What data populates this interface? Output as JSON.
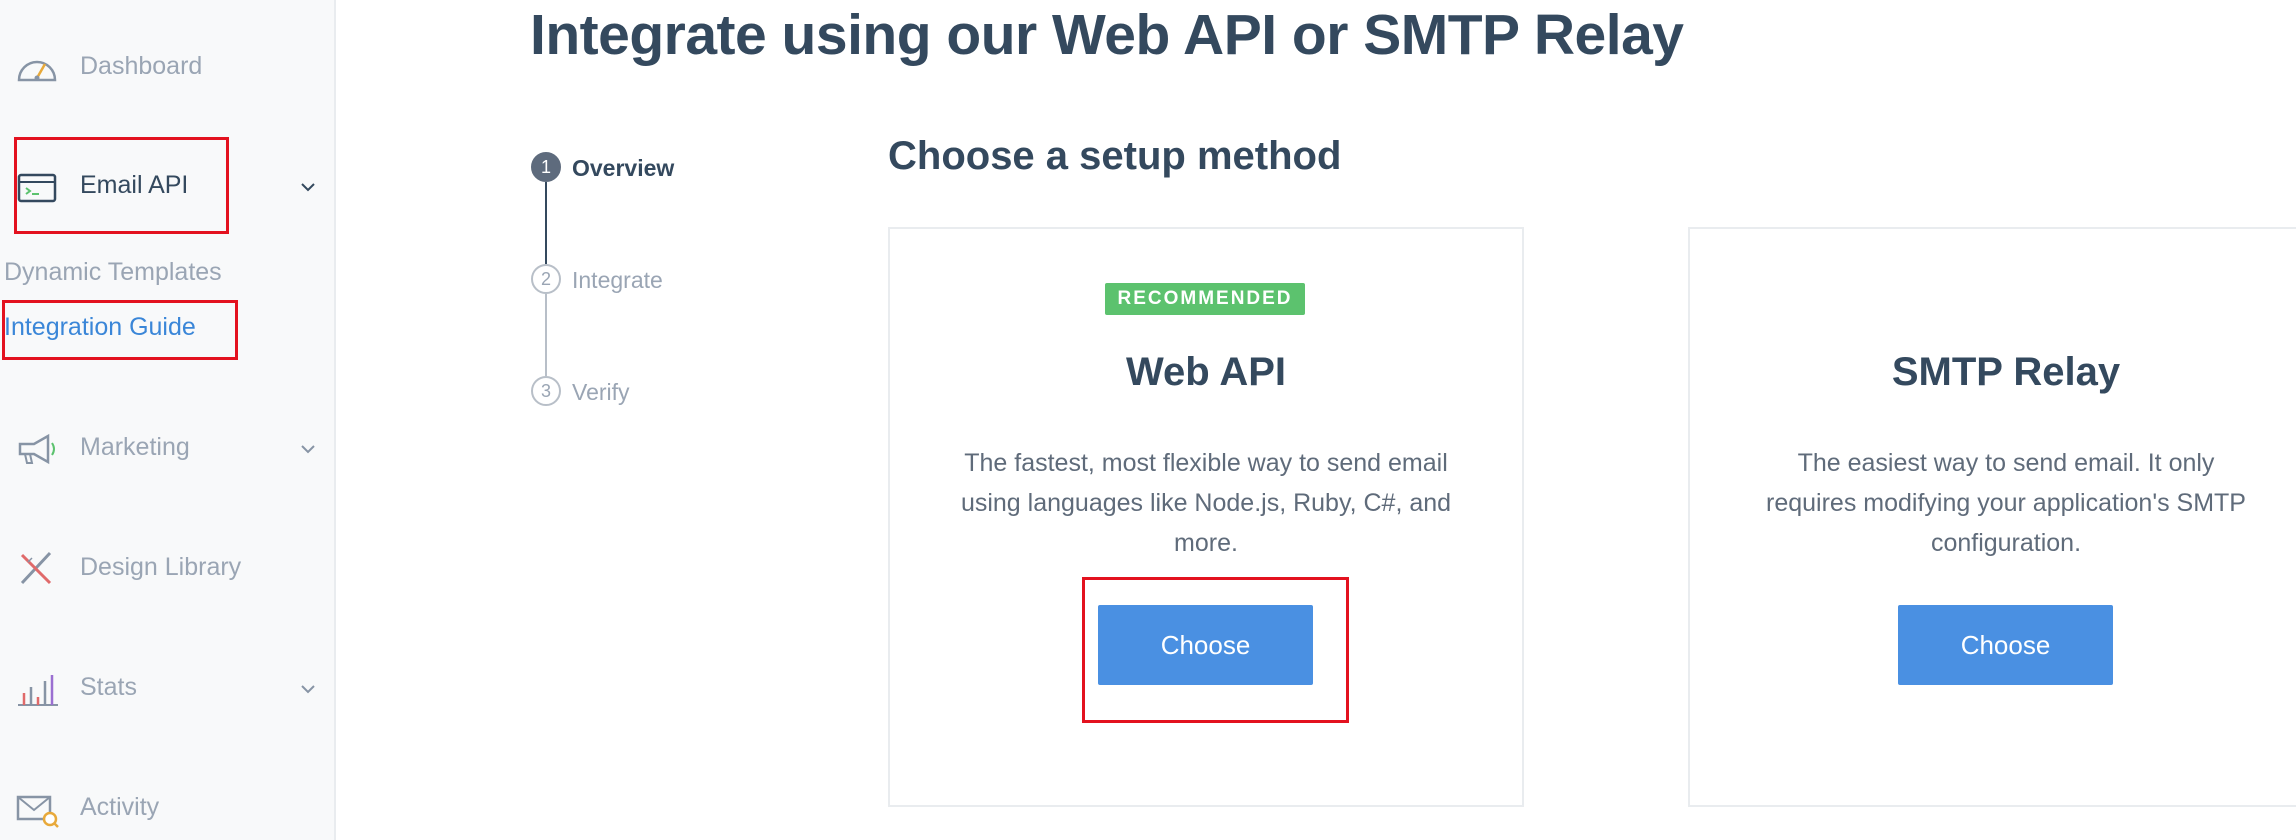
{
  "sidebar": {
    "items": [
      {
        "label": "Dashboard",
        "icon": "speedometer-icon"
      },
      {
        "label": "Email API",
        "icon": "terminal-window-icon"
      },
      {
        "label": "Marketing",
        "icon": "megaphone-icon"
      },
      {
        "label": "Design Library",
        "icon": "pencil-ruler-icon"
      },
      {
        "label": "Stats",
        "icon": "bar-chart-icon"
      },
      {
        "label": "Activity",
        "icon": "mail-search-icon"
      }
    ],
    "subitems": [
      {
        "label": "Dynamic Templates"
      },
      {
        "label": "Integration Guide"
      }
    ]
  },
  "main": {
    "title": "Integrate using our Web API or SMTP Relay",
    "steps": [
      {
        "num": "1",
        "label": "Overview"
      },
      {
        "num": "2",
        "label": "Integrate"
      },
      {
        "num": "3",
        "label": "Verify"
      }
    ],
    "section_title": "Choose a setup method",
    "cards": [
      {
        "badge": "RECOMMENDED",
        "title": "Web API",
        "description": "The fastest, most flexible way to send email using languages like Node.js, Ruby, C#, and more.",
        "button": "Choose"
      },
      {
        "title": "SMTP Relay",
        "description": "The easiest way to send email. It only requires modifying your application's SMTP configuration.",
        "button": "Choose"
      }
    ]
  },
  "colors": {
    "highlight": "#e3121f",
    "accent": "#4a90e2",
    "badge": "#5cc26e",
    "link": "#3a86d8",
    "heading": "#34495e"
  }
}
